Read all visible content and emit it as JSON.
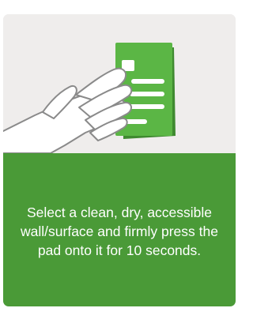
{
  "card": {
    "illustration_icon": "hand-pressing-pad-icon",
    "caption": "Select a clean, dry, accessible wall/surface and firmly press the pad onto it for 10 seconds."
  },
  "colors": {
    "card_background": "#efedec",
    "panel_green": "#4a9a37",
    "pad_green": "#5bb645",
    "pad_green_dark": "#3f8a30",
    "caption_text": "#ffffff"
  }
}
